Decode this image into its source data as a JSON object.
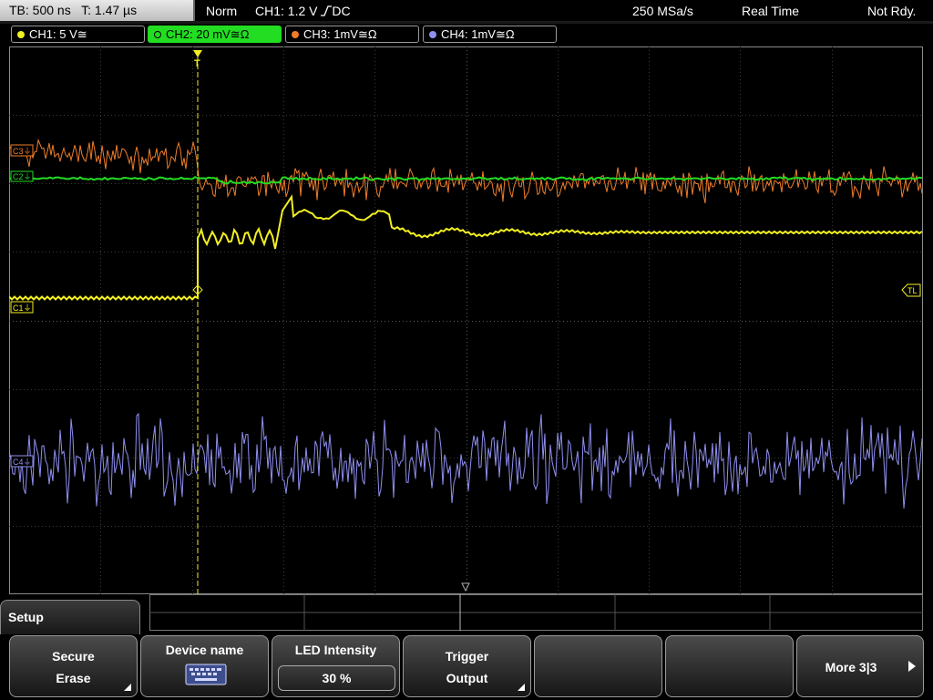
{
  "status": {
    "timebase": "TB: 500 ns",
    "trigger_time": "T: 1.47 µs",
    "mode": "Norm",
    "trigger_source": "CH1: 1.2 V",
    "trigger_coupling": "DC",
    "sample_rate": "250 MSa/s",
    "acquisition": "Real Time",
    "state": "Not Rdy."
  },
  "channels": [
    {
      "label": "CH1: 5 V≅",
      "color": "#f2ef22"
    },
    {
      "label": "CH2: 20 mV≅Ω",
      "color": "#22dd22"
    },
    {
      "label": "CH3: 1mV≅Ω",
      "color": "#f07d2a"
    },
    {
      "label": "CH4: 1mV≅Ω",
      "color": "#8f8ff0"
    }
  ],
  "markers": {
    "c3": "C3⏚",
    "c1": "C1⏚",
    "c2": "C2⏚",
    "c4": "C4⏚",
    "trigger_level": "TL",
    "trigger_position": "T"
  },
  "menu": {
    "title": "Setup",
    "softkeys": {
      "secure_erase_1": "Secure",
      "secure_erase_2": "Erase",
      "device_name": "Device name",
      "led_intensity": "LED Intensity",
      "led_value": "30 %",
      "trigger_output_1": "Trigger",
      "trigger_output_2": "Output",
      "more": "More 3|3"
    }
  },
  "icons": {
    "keyboard": "keyboard-icon",
    "trigger_marker": "trigger-marker-icon",
    "more_arrow": "arrow-right-icon"
  }
}
